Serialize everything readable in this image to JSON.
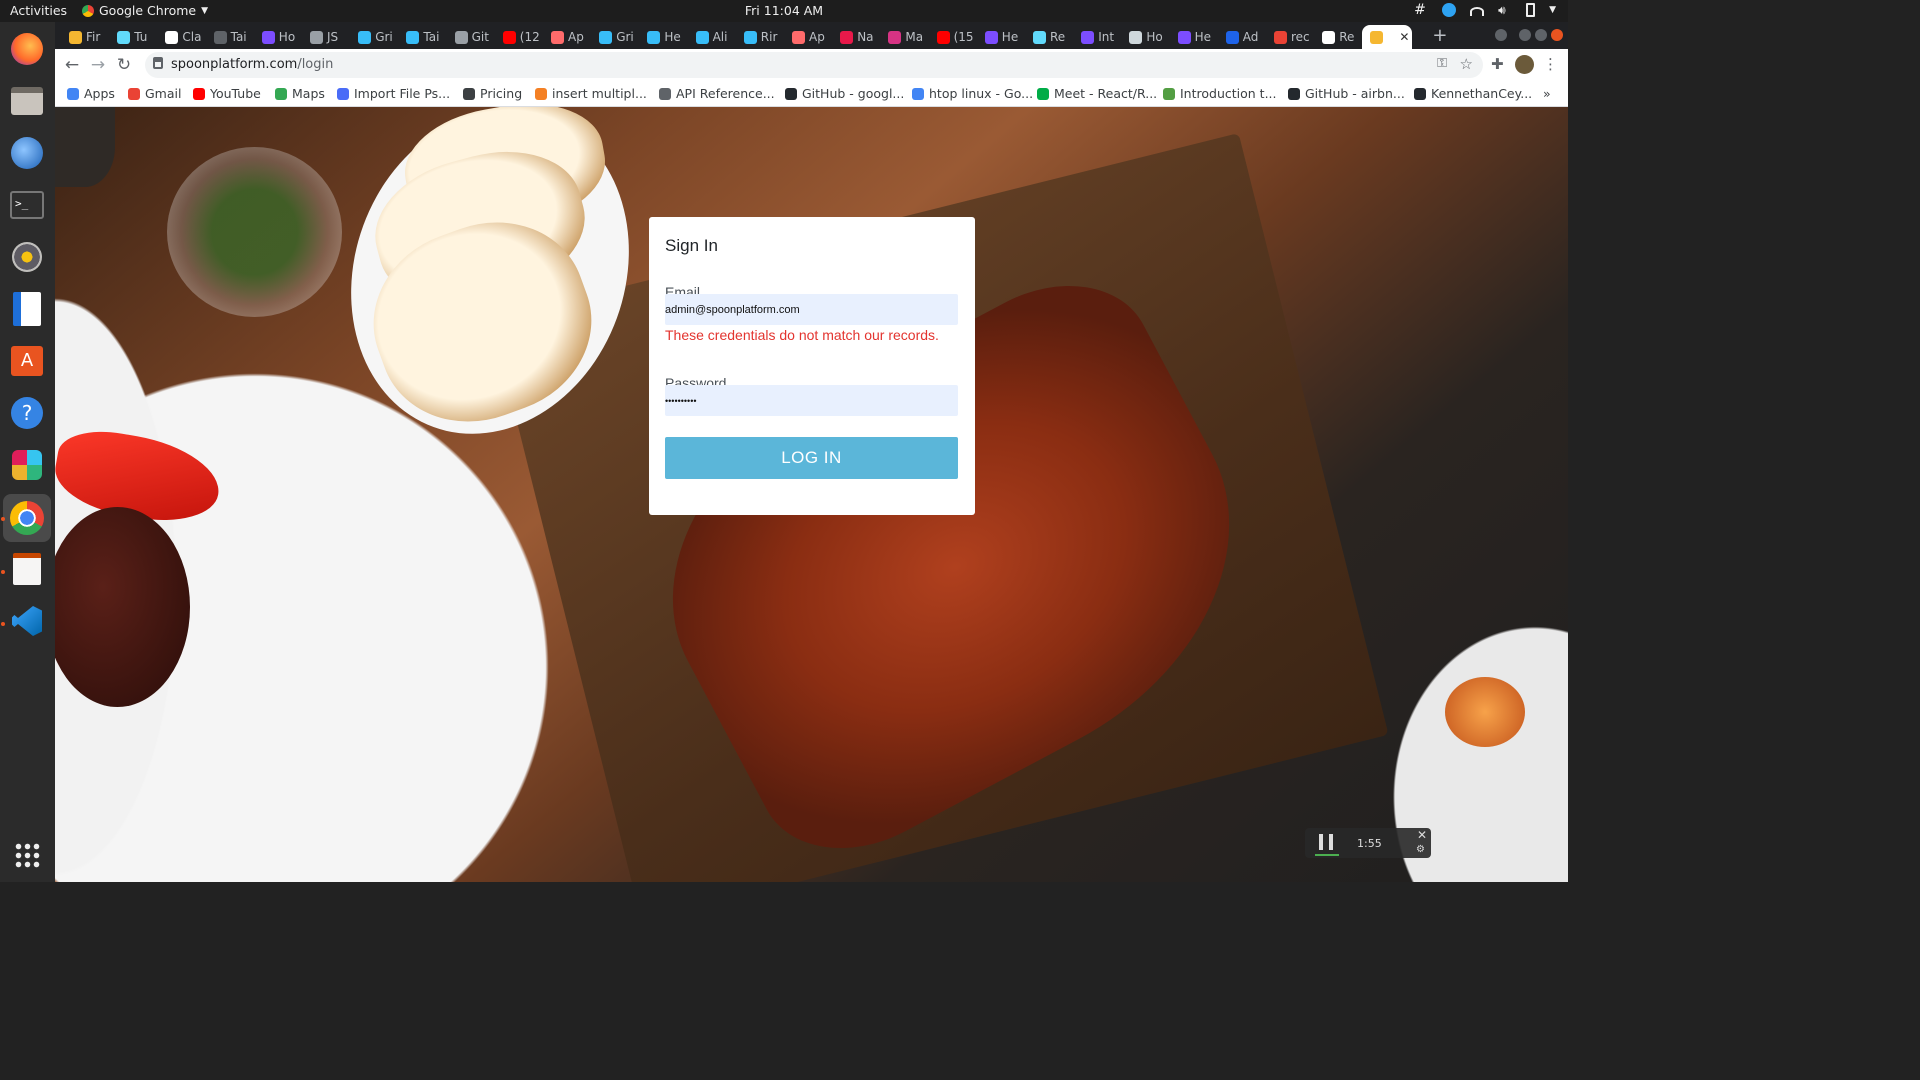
{
  "topbar": {
    "activities": "Activities",
    "app_name": "Google Chrome",
    "clock": "Fri 11:04 AM"
  },
  "dock": {
    "items": [
      "firefox-icon",
      "files-icon",
      "thunderbird-icon",
      "terminal-icon",
      "rhythmbox-icon",
      "writer-icon",
      "software-icon",
      "help-icon",
      "slack-icon",
      "chrome-icon",
      "text-editor-icon",
      "vscode-icon"
    ]
  },
  "tabs": [
    {
      "label": "Fir",
      "color": "#f5b731"
    },
    {
      "label": "Tu",
      "color": "#61dafb"
    },
    {
      "label": "Cla",
      "color": "#ffffff"
    },
    {
      "label": "Tai",
      "color": "#5f6368"
    },
    {
      "label": "Ho",
      "color": "#7c4dff"
    },
    {
      "label": "JS",
      "color": "#9aa0a6"
    },
    {
      "label": "Gri",
      "color": "#38bdf8"
    },
    {
      "label": "Tai",
      "color": "#38bdf8"
    },
    {
      "label": "Git",
      "color": "#9aa0a6"
    },
    {
      "label": "(12",
      "color": "#ff0000"
    },
    {
      "label": "Ap",
      "color": "#ff6b6b"
    },
    {
      "label": "Gri",
      "color": "#38bdf8"
    },
    {
      "label": "He",
      "color": "#38bdf8"
    },
    {
      "label": "Ali",
      "color": "#38bdf8"
    },
    {
      "label": "Rir",
      "color": "#38bdf8"
    },
    {
      "label": "Ap",
      "color": "#ff6b6b"
    },
    {
      "label": "Na",
      "color": "#e8194a"
    },
    {
      "label": "Ma",
      "color": "#d63384"
    },
    {
      "label": "(15",
      "color": "#ff0000"
    },
    {
      "label": "He",
      "color": "#7c4dff"
    },
    {
      "label": "Re",
      "color": "#61dafb"
    },
    {
      "label": "Int",
      "color": "#7c4dff"
    },
    {
      "label": "Ho",
      "color": "#cfd8dc"
    },
    {
      "label": "He",
      "color": "#7c4dff"
    },
    {
      "label": "Ad",
      "color": "#1e63e9"
    },
    {
      "label": "rec",
      "color": "#ea4335"
    },
    {
      "label": "Re",
      "color": "#ffffff"
    }
  ],
  "active_tab_close": "✕",
  "new_tab": "+",
  "address": {
    "host": "spoonplatform.com",
    "path": "/login"
  },
  "bookmarks": [
    {
      "label": "Apps",
      "icon": "apps-grid-icon",
      "color": "#4285f4"
    },
    {
      "label": "Gmail",
      "icon": "gmail-icon",
      "color": "#ea4335"
    },
    {
      "label": "YouTube",
      "icon": "youtube-icon",
      "color": "#ff0000"
    },
    {
      "label": "Maps",
      "icon": "maps-icon",
      "color": "#34a853"
    },
    {
      "label": "Import File Ps...",
      "icon": "doc-icon",
      "color": "#4a6cf7"
    },
    {
      "label": "Pricing",
      "icon": "pricing-icon",
      "color": "#3c4043"
    },
    {
      "label": "insert multipl...",
      "icon": "stackoverflow-icon",
      "color": "#f48024"
    },
    {
      "label": "API Reference...",
      "icon": "code-icon",
      "color": "#5f6368"
    },
    {
      "label": "GitHub - googl...",
      "icon": "github-icon",
      "color": "#24292e"
    },
    {
      "label": "htop linux - Go...",
      "icon": "google-icon",
      "color": "#4285f4"
    },
    {
      "label": "Meet - React/R...",
      "icon": "meet-icon",
      "color": "#00ac47"
    },
    {
      "label": "Introduction t...",
      "icon": "node-icon",
      "color": "#539e43"
    },
    {
      "label": "GitHub - airbn...",
      "icon": "github-icon",
      "color": "#24292e"
    },
    {
      "label": "KennethanCey...",
      "icon": "github-icon",
      "color": "#24292e"
    }
  ],
  "bookmarks_more": "»",
  "signin": {
    "title": "Sign In",
    "email_label": "Email",
    "email_value": "admin@spoonplatform.com",
    "error": "These credentials do not match our records.",
    "password_label": "Password",
    "password_value": "••••••••••",
    "login_button": "LOG IN",
    "button_color": "#5bb6d9",
    "error_color": "#e3342f"
  },
  "recorder": {
    "time": "1:55",
    "close": "✕"
  }
}
